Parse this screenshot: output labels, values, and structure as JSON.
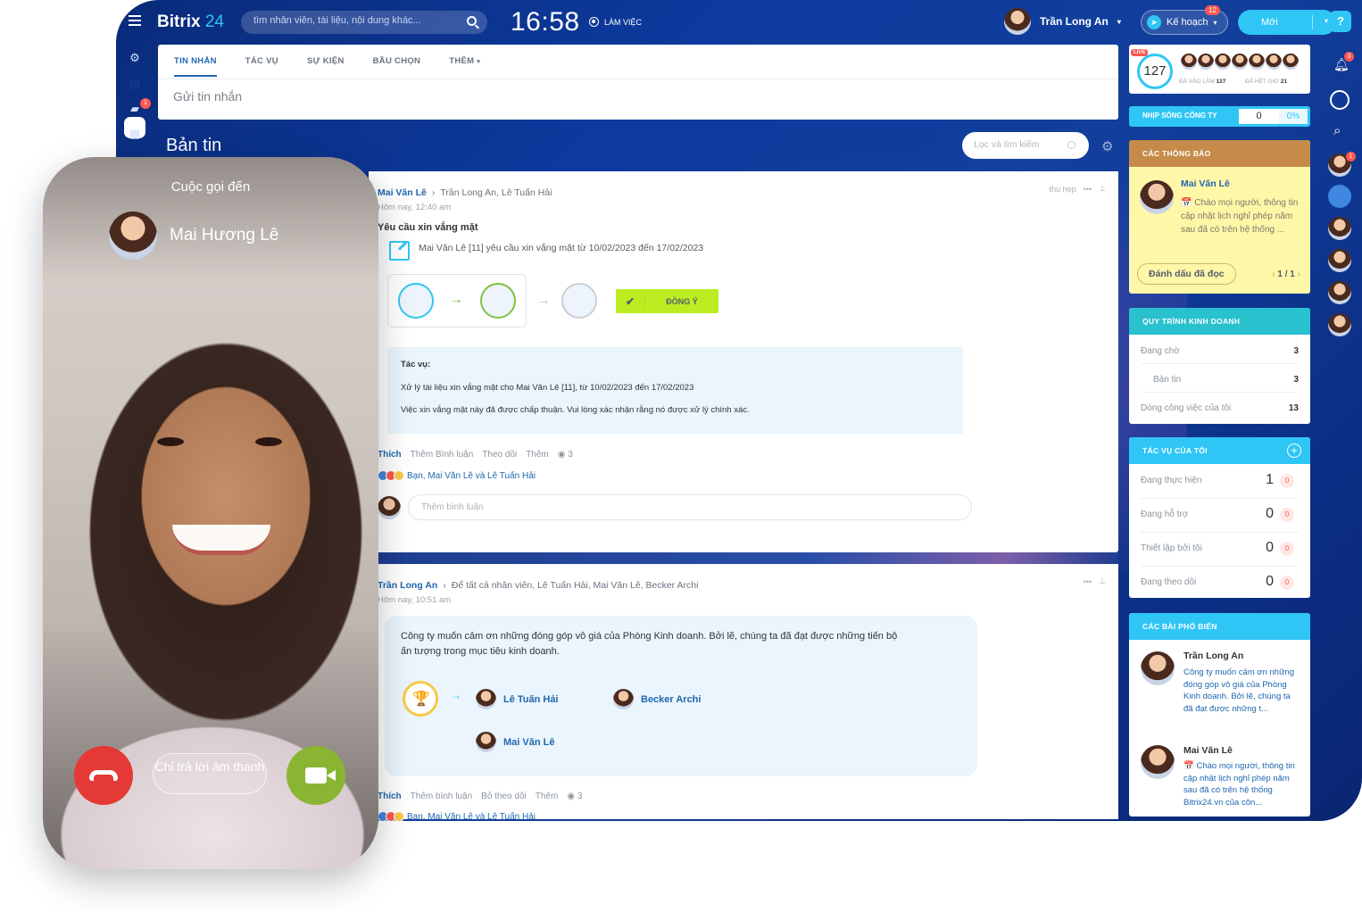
{
  "topbar": {
    "logo_main": "Bitrix",
    "logo_num": "24",
    "search_placeholder": "tìm nhân viên, tài liệu, nội dung khác...",
    "clock": "16:58",
    "work_status": "LÀM VIỆC",
    "user_name": "Trần Long An",
    "plan_label": "Kế hoạch",
    "plan_badge": "12",
    "new_label": "Mới"
  },
  "leftnav": {
    "chat_badge": "1"
  },
  "composer": {
    "tabs": [
      "TIN NHẮN",
      "TÁC VỤ",
      "SỰ KIỆN",
      "BẦU CHỌN",
      "THÊM"
    ],
    "placeholder": "Gửi tin nhắn"
  },
  "feed": {
    "title": "Bản tin",
    "filter_placeholder": "Lọc và tìm kiếm"
  },
  "post1": {
    "author": "Mai Văn Lê",
    "recipients": "Trần Long An, Lê Tuấn Hải",
    "time": "Hôm nay, 12:40 am",
    "collapse": "thu hẹp",
    "title": "Yêu cầu xin vắng mặt",
    "request": "Mai Văn Lê [11] yêu cầu xin vắng mặt từ 10/02/2023 đến 17/02/2023",
    "approve_label": "ĐỒNG Ý",
    "task_heading": "Tác vụ:",
    "task_line1": "Xử lý tài liệu xin vắng mặt cho Mai Văn Lê [11], từ 10/02/2023 đến 17/02/2023",
    "task_line2": "Việc xin vắng mặt này đã được chấp thuận. Vui lòng xác nhận rằng nó được xử lý chính xác.",
    "actions": {
      "like": "Thích",
      "comment": "Thêm Bình luận",
      "follow": "Theo dõi",
      "more": "Thêm",
      "views": "3"
    },
    "reactions": "Bạn, Mai Văn Lê và Lê Tuấn Hải",
    "comment_placeholder": "Thêm bình luận"
  },
  "post2": {
    "author": "Trần Long An",
    "recipients": "Để tất cả nhân viên, Lê Tuấn Hải, Mai Văn Lê, Becker Archi",
    "time": "Hôm nay, 10:51 am",
    "text": "Công ty muốn  cảm ơn những đóng góp vô giá của Phòng Kinh doanh. Bởi lẽ, chúng ta đã đạt được những tiến bộ ấn tượng trong mục tiêu kinh doanh.",
    "receivers": [
      "Lê Tuấn Hải",
      "Becker Archi",
      "Mai Văn Lê"
    ],
    "actions": {
      "like": "Thích",
      "comment": "Thêm bình luận",
      "follow": "Bỏ theo dõi",
      "more": "Thêm",
      "views": "3"
    },
    "reactions": "Bạn, Mai Văn Lê và Lê Tuấn Hải"
  },
  "attendance": {
    "live": "LIVE",
    "count": "127",
    "in_label": "ĐÃ VÀO LÀM",
    "in_count": "127",
    "out_label": "ĐÃ HẾT GIỜ",
    "out_count": "21"
  },
  "pulse": {
    "label": "NHỊP SỐNG CÔNG TY",
    "value": "0",
    "percent": "0%"
  },
  "notices": {
    "heading": "CÁC THÔNG BÁO",
    "author": "Mai Văn Lê",
    "text": "Chào mọi người, thông tin cập nhật lịch nghỉ phép năm sau đã có trên hệ thống ...",
    "mark_read": "Đánh dấu đã đọc",
    "pager": "1 / 1"
  },
  "workflows": {
    "heading": "QUY TRÌNH KINH DOANH",
    "rows": [
      {
        "label": "Đang chờ",
        "value": "3"
      },
      {
        "label": "Bản tin",
        "value": "3"
      },
      {
        "label": "Dòng công việc của tôi",
        "value": "13"
      }
    ]
  },
  "mytasks": {
    "heading": "TÁC VỤ CỦA TÔI",
    "rows": [
      {
        "label": "Đang thực hiện",
        "value": "1",
        "badge": "0"
      },
      {
        "label": "Đang hỗ trợ",
        "value": "0",
        "badge": "0"
      },
      {
        "label": "Thiết lập bởi tôi",
        "value": "0",
        "badge": "0"
      },
      {
        "label": "Đang theo dõi",
        "value": "0",
        "badge": "0"
      }
    ]
  },
  "popular": {
    "heading": "CÁC BÀI PHỔ BIẾN",
    "items": [
      {
        "author": "Trần Long An",
        "text": "Công ty muốn cảm ơn những đóng góp vô giá của Phòng Kinh doanh. Bởi lẽ, chúng ta đã đạt được những t..."
      },
      {
        "author": "Mai Văn Lê",
        "text": "Chào mọi người, thông tin cập nhật lịch nghỉ phép năm sau đã có trên hệ thống Bitrix24.vn của côn..."
      }
    ]
  },
  "rightbar": {
    "help": "?",
    "notif_badge": "3",
    "chat_badge": "1"
  },
  "call": {
    "title": "Cuộc gọi đến",
    "caller": "Mai Hương Lê",
    "audio_only": "Chỉ trả lời âm thanh"
  },
  "colors": {
    "accent": "#2fc6f6",
    "link": "#2067b0",
    "approve": "#bbed21",
    "decline": "#e53935",
    "video": "#8ab532"
  }
}
